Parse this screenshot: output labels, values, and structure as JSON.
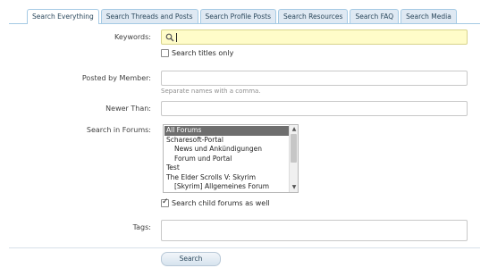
{
  "tabs": [
    {
      "label": "Search Everything"
    },
    {
      "label": "Search Threads and Posts"
    },
    {
      "label": "Search Profile Posts"
    },
    {
      "label": "Search Resources"
    },
    {
      "label": "Search FAQ"
    },
    {
      "label": "Search Media"
    }
  ],
  "keywords": {
    "label": "Keywords:",
    "value": ""
  },
  "titles_only": {
    "label": "Search titles only",
    "checked": false
  },
  "posted_by": {
    "label": "Posted by Member:",
    "value": "",
    "hint": "Separate names with a comma."
  },
  "newer_than": {
    "label": "Newer Than:",
    "value": ""
  },
  "forums": {
    "label": "Search in Forums:",
    "options": [
      {
        "label": "All Forums",
        "selected": true,
        "level": 0
      },
      {
        "label": "Scharesoft-Portal",
        "selected": false,
        "level": 0
      },
      {
        "label": "News und Ankündigungen",
        "selected": false,
        "level": 1
      },
      {
        "label": "Forum und Portal",
        "selected": false,
        "level": 1
      },
      {
        "label": "Test",
        "selected": false,
        "level": 0
      },
      {
        "label": "The Elder Scrolls V: Skyrim",
        "selected": false,
        "level": 0
      },
      {
        "label": "[Skyrim] Allgemeines Forum",
        "selected": false,
        "level": 1
      }
    ]
  },
  "child_forums": {
    "label": "Search child forums as well",
    "checked": true
  },
  "tags": {
    "label": "Tags:",
    "value": ""
  },
  "submit": {
    "label": "Search"
  }
}
